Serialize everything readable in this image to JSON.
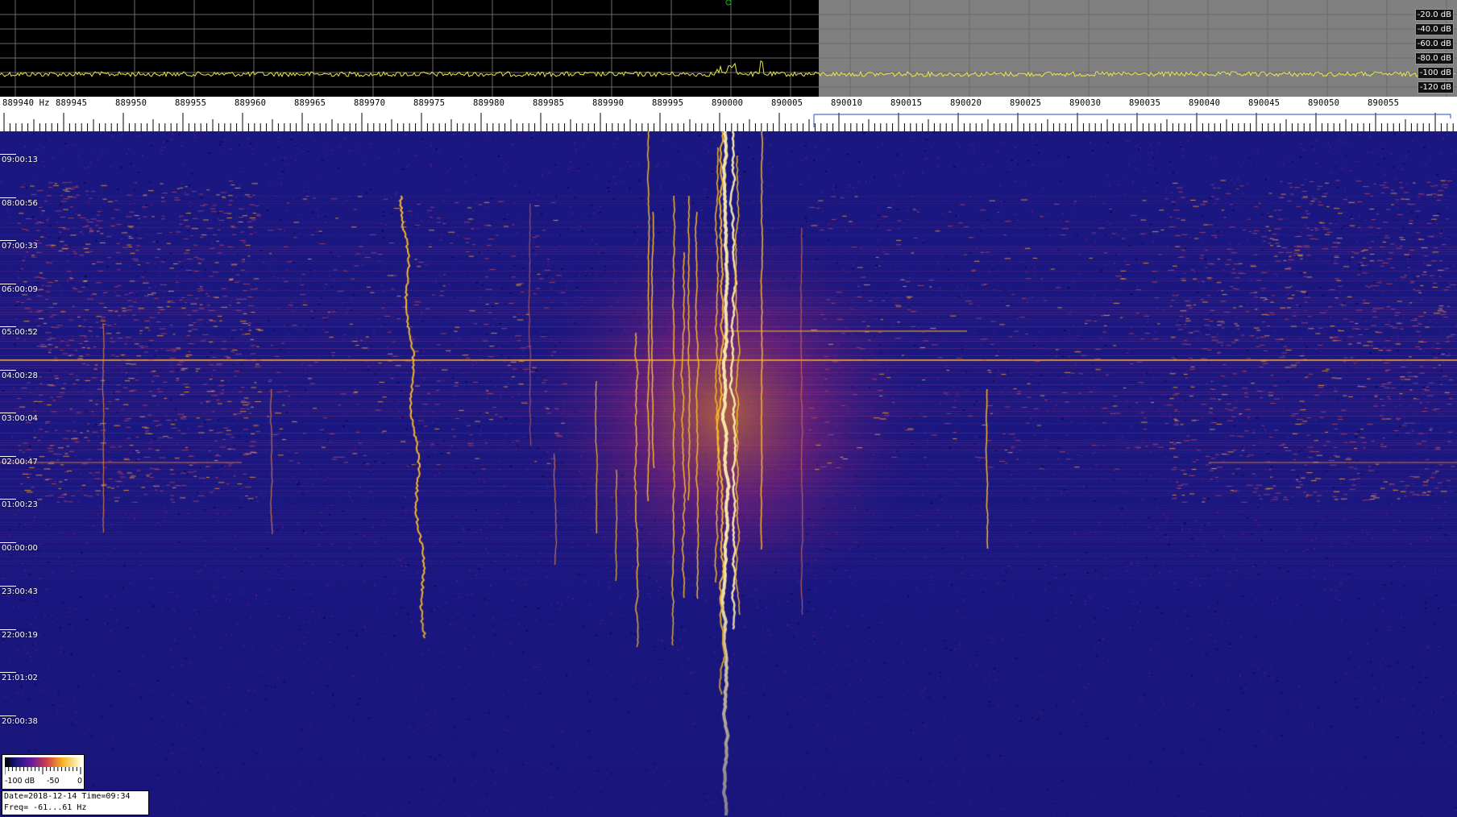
{
  "spectrum": {
    "db_labels": [
      "-20.0 dB",
      "-40.0 dB",
      "-60.0 dB",
      "-80.0 dB",
      "-100 dB",
      "-120 dB"
    ]
  },
  "ruler": {
    "first_label": "889940 Hz",
    "labels": [
      "889945",
      "889950",
      "889955",
      "889960",
      "889965",
      "889970",
      "889975",
      "889980",
      "889985",
      "889990",
      "889995",
      "890000",
      "890005",
      "890010",
      "890015",
      "890020",
      "890025",
      "890030",
      "890035",
      "890040",
      "890045",
      "890050",
      "890055"
    ]
  },
  "waterfall": {
    "time_labels": [
      "09:00:13",
      "08:00:56",
      "07:00:33",
      "06:00:09",
      "05:00:52",
      "04:00:28",
      "03:00:04",
      "02:00:47",
      "01:00:23",
      "00:00:00",
      "23:00:43",
      "22:00:19",
      "21:01:02",
      "20:00:38"
    ]
  },
  "colorbar": {
    "min_label": "-100 dB",
    "mid_label": "-50",
    "max_label": "0"
  },
  "info": {
    "date_time": "Date=2018-12-14 Time=09:34",
    "freq": "Freq= -61...61 Hz"
  },
  "colors": {
    "background": "#1a1780",
    "trace": "#e8e84a",
    "signal": "#f7b020",
    "signal_core": "#fff3b0"
  }
}
